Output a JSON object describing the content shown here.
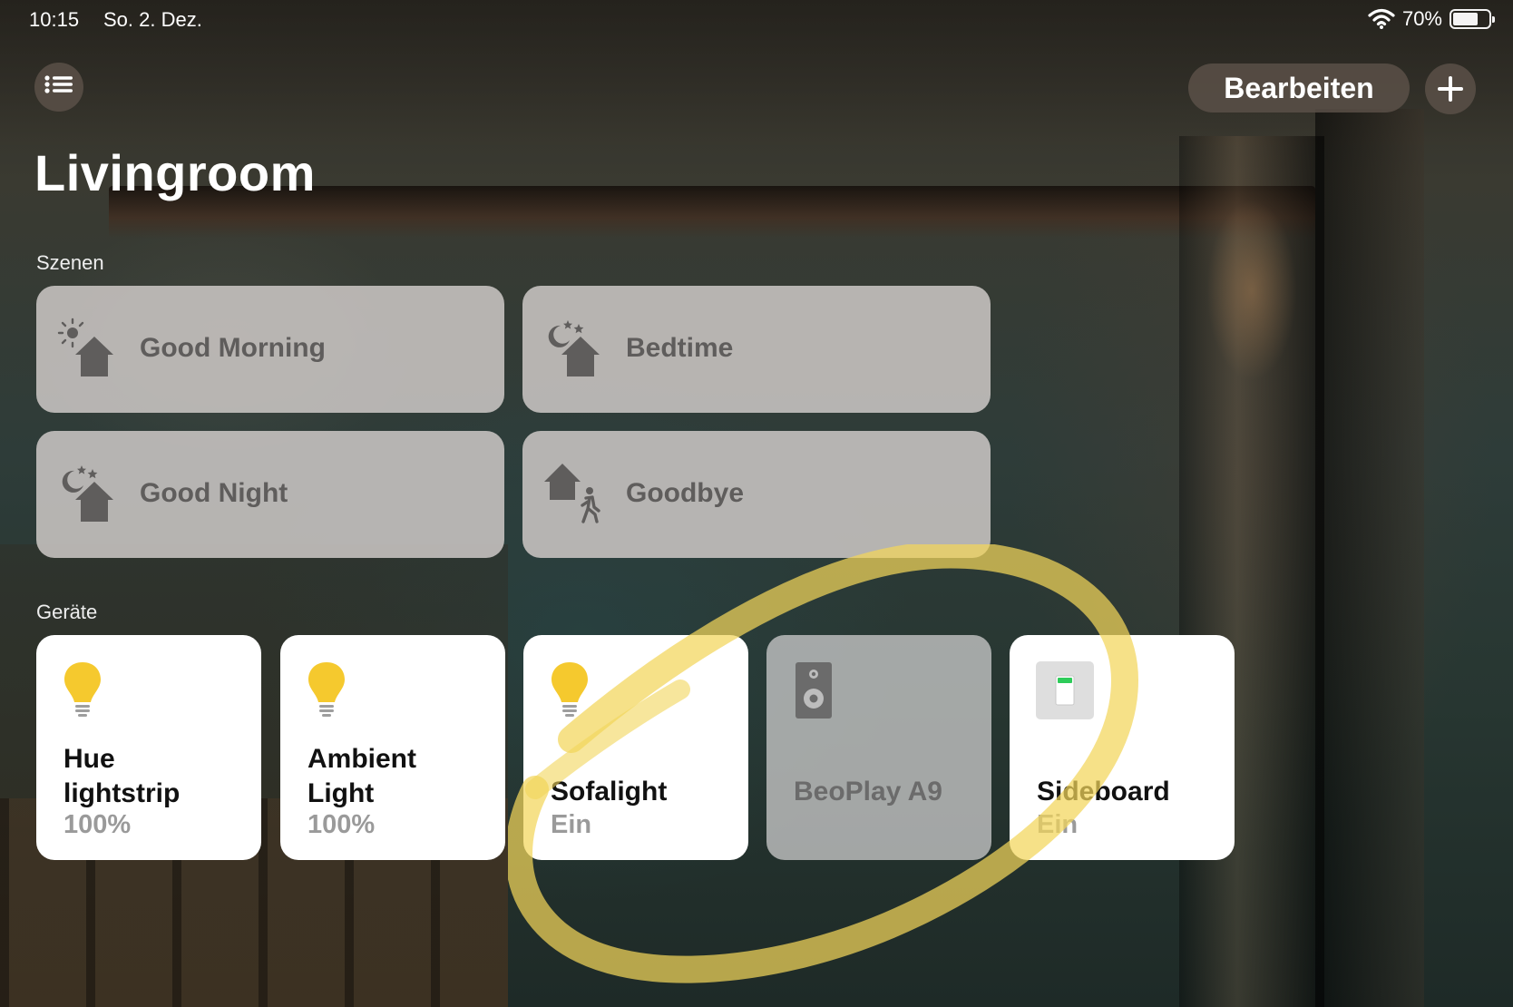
{
  "status_bar": {
    "time": "10:15",
    "date": "So. 2. Dez.",
    "battery_percent_label": "70%",
    "battery_level": 0.7,
    "wifi_icon": "wifi-icon",
    "battery_icon": "battery-icon"
  },
  "toolbar": {
    "menu_icon": "list-icon",
    "edit_label": "Bearbeiten",
    "add_icon": "plus-icon"
  },
  "page": {
    "title": "Livingroom"
  },
  "scenes": {
    "label": "Szenen",
    "items": [
      {
        "name": "Good Morning",
        "icon": "sun-house-icon"
      },
      {
        "name": "Bedtime",
        "icon": "moon-house-icon"
      },
      {
        "name": "Good Night",
        "icon": "moon-house-icon"
      },
      {
        "name": "Goodbye",
        "icon": "house-walking-person-icon"
      }
    ]
  },
  "devices": {
    "label": "Geräte",
    "items": [
      {
        "name_line1": "Hue",
        "name_line2": "lightstrip",
        "status": "100%",
        "icon": "lightbulb-icon",
        "on": true
      },
      {
        "name_line1": "Ambient",
        "name_line2": "Light",
        "status": "100%",
        "icon": "lightbulb-icon",
        "on": true
      },
      {
        "name": "Sofalight",
        "status": "Ein",
        "icon": "lightbulb-icon",
        "on": true
      },
      {
        "name": "BeoPlay A9",
        "status": "",
        "icon": "speaker-icon",
        "on": false
      },
      {
        "name": "Sideboard",
        "status": "Ein",
        "icon": "switch-icon",
        "on": true
      }
    ]
  },
  "colors": {
    "bulb_on": "#f5c92e",
    "scene_tile_bg": "#cdc8c6",
    "highlight_ring": "#f2d55a",
    "switch_indicator": "#2ecc5a"
  }
}
